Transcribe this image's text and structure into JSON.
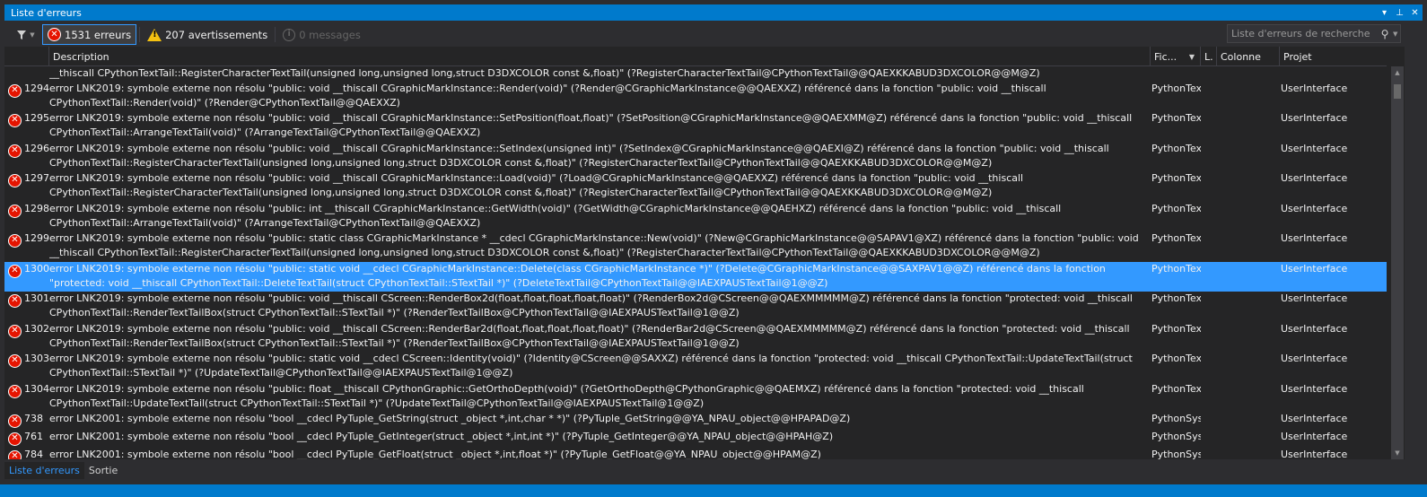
{
  "window": {
    "title": "Liste d'erreurs",
    "buttons": [
      "▾",
      "⊥",
      "✕"
    ]
  },
  "toolbar": {
    "errors_label": "1531 erreurs",
    "warnings_label": "207 avertissements",
    "messages_label": "0 messages",
    "search_placeholder": "Liste d'erreurs de recherche"
  },
  "columns": {
    "description": "Description",
    "file": "Fic...",
    "line": "L.",
    "column": "Colonne",
    "project": "Projet"
  },
  "rows": [
    {
      "code": "",
      "desc": "__thiscall CPythonTextTail::RegisterCharacterTextTail(unsigned long,unsigned long,struct D3DXCOLOR const &,float)\" (?RegisterCharacterTextTail@CPythonTextTail@@QAEXKKABUD3DXCOLOR@@M@Z)",
      "file": "",
      "project": "",
      "icon": false,
      "selected": false
    },
    {
      "code": "1294",
      "desc": "error LNK2019: symbole externe non résolu \"public: void __thiscall CGraphicMarkInstance::Render(void)\" (?Render@CGraphicMarkInstance@@QAEXXZ) référencé dans la fonction \"public: void __thiscall CPythonTextTail::Render(void)\" (?Render@CPythonTextTail@@QAEXXZ)",
      "file": "PythonTex",
      "project": "UserInterface",
      "icon": true,
      "selected": false
    },
    {
      "code": "1295",
      "desc": "error LNK2019: symbole externe non résolu \"public: void __thiscall CGraphicMarkInstance::SetPosition(float,float)\" (?SetPosition@CGraphicMarkInstance@@QAEXMM@Z) référencé dans la fonction \"public: void __thiscall CPythonTextTail::ArrangeTextTail(void)\" (?ArrangeTextTail@CPythonTextTail@@QAEXXZ)",
      "file": "PythonTex",
      "project": "UserInterface",
      "icon": true,
      "selected": false
    },
    {
      "code": "1296",
      "desc": "error LNK2019: symbole externe non résolu \"public: void __thiscall CGraphicMarkInstance::SetIndex(unsigned int)\" (?SetIndex@CGraphicMarkInstance@@QAEXI@Z) référencé dans la fonction \"public: void __thiscall CPythonTextTail::RegisterCharacterTextTail(unsigned long,unsigned long,struct D3DXCOLOR const &,float)\" (?RegisterCharacterTextTail@CPythonTextTail@@QAEXKKABUD3DXCOLOR@@M@Z)",
      "file": "PythonTex",
      "project": "UserInterface",
      "icon": true,
      "selected": false
    },
    {
      "code": "1297",
      "desc": "error LNK2019: symbole externe non résolu \"public: void __thiscall CGraphicMarkInstance::Load(void)\" (?Load@CGraphicMarkInstance@@QAEXXZ) référencé dans la fonction \"public: void __thiscall CPythonTextTail::RegisterCharacterTextTail(unsigned long,unsigned long,struct D3DXCOLOR const &,float)\" (?RegisterCharacterTextTail@CPythonTextTail@@QAEXKKABUD3DXCOLOR@@M@Z)",
      "file": "PythonTex",
      "project": "UserInterface",
      "icon": true,
      "selected": false
    },
    {
      "code": "1298",
      "desc": "error LNK2019: symbole externe non résolu \"public: int __thiscall CGraphicMarkInstance::GetWidth(void)\" (?GetWidth@CGraphicMarkInstance@@QAEHXZ) référencé dans la fonction \"public: void __thiscall CPythonTextTail::ArrangeTextTail(void)\" (?ArrangeTextTail@CPythonTextTail@@QAEXXZ)",
      "file": "PythonTex",
      "project": "UserInterface",
      "icon": true,
      "selected": false
    },
    {
      "code": "1299",
      "desc": "error LNK2019: symbole externe non résolu \"public: static class CGraphicMarkInstance * __cdecl CGraphicMarkInstance::New(void)\" (?New@CGraphicMarkInstance@@SAPAV1@XZ) référencé dans la fonction \"public: void __thiscall CPythonTextTail::RegisterCharacterTextTail(unsigned long,unsigned long,struct D3DXCOLOR const &,float)\" (?RegisterCharacterTextTail@CPythonTextTail@@QAEXKKABUD3DXCOLOR@@M@Z)",
      "file": "PythonTex",
      "project": "UserInterface",
      "icon": true,
      "selected": false
    },
    {
      "code": "1300",
      "desc": "error LNK2019: symbole externe non résolu \"public: static void __cdecl CGraphicMarkInstance::Delete(class CGraphicMarkInstance *)\" (?Delete@CGraphicMarkInstance@@SAXPAV1@@Z) référencé dans la fonction \"protected: void __thiscall CPythonTextTail::DeleteTextTail(struct CPythonTextTail::STextTail *)\" (?DeleteTextTail@CPythonTextTail@@IAEXPAUSTextTail@1@@Z)",
      "file": "PythonTex",
      "project": "UserInterface",
      "icon": true,
      "selected": true
    },
    {
      "code": "1301",
      "desc": "error LNK2019: symbole externe non résolu \"public: void __thiscall CScreen::RenderBox2d(float,float,float,float,float)\" (?RenderBox2d@CScreen@@QAEXMMMMM@Z) référencé dans la fonction \"protected: void __thiscall CPythonTextTail::RenderTextTailBox(struct CPythonTextTail::STextTail *)\" (?RenderTextTailBox@CPythonTextTail@@IAEXPAUSTextTail@1@@Z)",
      "file": "PythonTex",
      "project": "UserInterface",
      "icon": true,
      "selected": false
    },
    {
      "code": "1302",
      "desc": "error LNK2019: symbole externe non résolu \"public: void __thiscall CScreen::RenderBar2d(float,float,float,float,float)\" (?RenderBar2d@CScreen@@QAEXMMMMM@Z) référencé dans la fonction \"protected: void __thiscall CPythonTextTail::RenderTextTailBox(struct CPythonTextTail::STextTail *)\" (?RenderTextTailBox@CPythonTextTail@@IAEXPAUSTextTail@1@@Z)",
      "file": "PythonTex",
      "project": "UserInterface",
      "icon": true,
      "selected": false
    },
    {
      "code": "1303",
      "desc": "error LNK2019: symbole externe non résolu \"public: static void __cdecl CScreen::Identity(void)\" (?Identity@CScreen@@SAXXZ) référencé dans la fonction \"protected: void __thiscall CPythonTextTail::UpdateTextTail(struct CPythonTextTail::STextTail *)\" (?UpdateTextTail@CPythonTextTail@@IAEXPAUSTextTail@1@@Z)",
      "file": "PythonTex",
      "project": "UserInterface",
      "icon": true,
      "selected": false
    },
    {
      "code": "1304",
      "desc": "error LNK2019: symbole externe non résolu \"public: float __thiscall CPythonGraphic::GetOrthoDepth(void)\" (?GetOrthoDepth@CPythonGraphic@@QAEMXZ) référencé dans la fonction \"protected: void __thiscall CPythonTextTail::UpdateTextTail(struct CPythonTextTail::STextTail *)\" (?UpdateTextTail@CPythonTextTail@@IAEXPAUSTextTail@1@@Z)",
      "file": "PythonTex",
      "project": "UserInterface",
      "icon": true,
      "selected": false
    },
    {
      "code": "738",
      "desc": "error LNK2001: symbole externe non résolu \"bool __cdecl PyTuple_GetString(struct _object *,int,char * *)\" (?PyTuple_GetString@@YA_NPAU_object@@HPAPAD@Z)",
      "file": "PythonSys",
      "project": "UserInterface",
      "icon": true,
      "selected": false
    },
    {
      "code": "761",
      "desc": "error LNK2001: symbole externe non résolu \"bool __cdecl PyTuple_GetInteger(struct _object *,int,int *)\" (?PyTuple_GetInteger@@YA_NPAU_object@@HPAH@Z)",
      "file": "PythonSys",
      "project": "UserInterface",
      "icon": true,
      "selected": false
    },
    {
      "code": "784",
      "desc": "error LNK2001: symbole externe non résolu \"bool __cdecl PyTuple_GetFloat(struct _object *,int,float *)\" (?PyTuple_GetFloat@@YA_NPAU_object@@HPAM@Z)",
      "file": "PythonSys",
      "project": "UserInterface",
      "icon": true,
      "selected": false
    }
  ],
  "tabs": [
    "Liste d'erreurs",
    "Sortie"
  ],
  "colors": {
    "accent": "#007acc",
    "selection": "#3399ff",
    "error": "#e51400",
    "warning": "#f5c211"
  }
}
